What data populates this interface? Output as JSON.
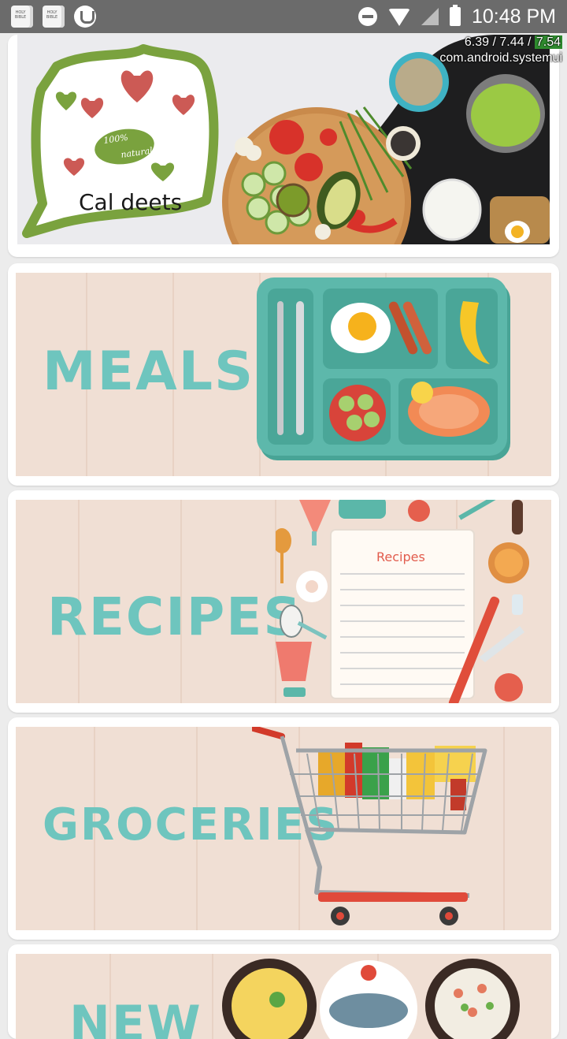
{
  "status_bar": {
    "time": "10:48 PM",
    "left_icons": [
      "holy-bible-icon",
      "holy-bible-icon",
      "utorrent-icon"
    ],
    "bible_text": "HOLY BIBLE",
    "right_icons": [
      "do-not-disturb-icon",
      "wifi-icon",
      "no-signal-icon",
      "battery-icon"
    ]
  },
  "overlay": {
    "load_a": "6.39 / 7.44 / ",
    "load_b": "7.54",
    "process": "com.android.systemui"
  },
  "hero": {
    "logo_text": "Cal deets",
    "badge_text_1": "100%",
    "badge_text_2": "natural"
  },
  "cards": {
    "meals": "MEALS",
    "recipes": "RECIPES",
    "recipes_note_title": "Recipes",
    "groceries": "GROCERIES",
    "new": "NEW"
  },
  "colors": {
    "label": "#6ec5be",
    "wood": "#f0dfd4",
    "logo_green": "#7aa23e",
    "heart_red": "#cc5a55",
    "tray": "#5db8ab"
  }
}
